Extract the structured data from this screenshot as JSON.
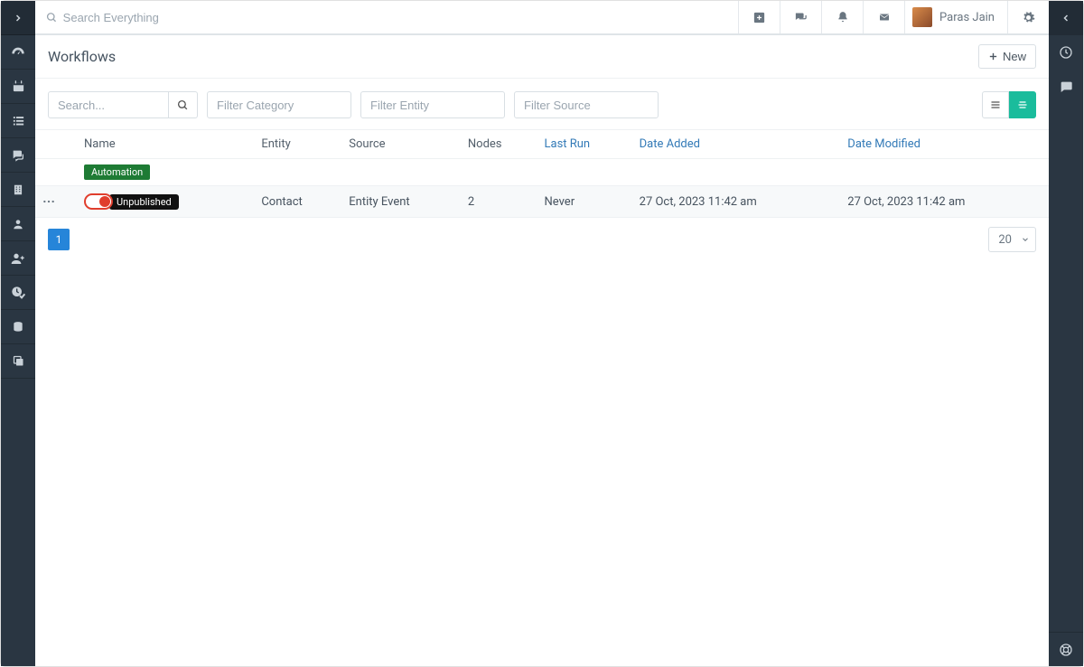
{
  "search_placeholder": "Search Everything",
  "user_name": "Paras Jain",
  "page_title": "Workflows",
  "new_button_label": "New",
  "filters": {
    "search_placeholder": "Search...",
    "category_placeholder": "Filter Category",
    "entity_placeholder": "Filter Entity",
    "source_placeholder": "Filter Source"
  },
  "columns": {
    "name": "Name",
    "entity": "Entity",
    "source": "Source",
    "nodes": "Nodes",
    "last_run": "Last Run",
    "date_added": "Date Added",
    "date_modified": "Date Modified"
  },
  "group_tag": "Automation",
  "row": {
    "status": "Unpublished",
    "entity": "Contact",
    "source": "Entity Event",
    "nodes": "2",
    "last_run": "Never",
    "date_added": "27 Oct, 2023 11:42 am",
    "date_modified": "27 Oct, 2023 11:42 am"
  },
  "pagination": {
    "current_page": "1",
    "per_page": "20"
  }
}
